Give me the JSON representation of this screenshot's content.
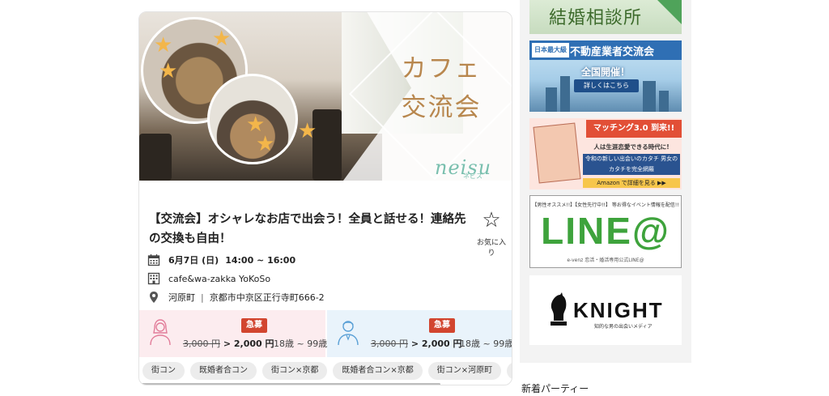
{
  "event": {
    "hero_title_line1": "カフェ",
    "hero_title_line2": "交流会",
    "hero_logo": "neisu",
    "hero_logo_sub": "ネビス",
    "title": "【交流会】オシャレなお店で出会う！全員と話せる！連絡先の交換も自由！",
    "favorite_label": "お気に入り",
    "date": "6月7日 (日)",
    "time": "14:00 ~ 16:00",
    "venue": "cafe&wa-zakka YoKoSo",
    "area": "河原町",
    "separator": "|",
    "address": "京都市中京区正行寺町666-2",
    "female": {
      "badge": "急募",
      "old_price": "3,000 円",
      "price": "> 2,000 円",
      "age": "18歳 ~ 99歳"
    },
    "male": {
      "badge": "急募",
      "old_price": "3,000 円",
      "price": "> 2,000 円",
      "age": "18歳 ~ 99歳"
    },
    "tags": [
      "街コン",
      "既婚者合コン",
      "街コン×京都",
      "既婚者合コン×京都",
      "街コン×河原町",
      "既"
    ]
  },
  "sidebar": {
    "banner1_title": "結婚相談所",
    "banner2_tag": "日本最大級",
    "banner2_title": "不動産業者交流会",
    "banner2_sub": "全国開催！",
    "banner2_button": "詳しくはこちら",
    "banner3_head": "マッチング3.0 到来!!",
    "banner3_line": "人は生涯恋愛できる時代に!",
    "banner3_box": "令和の新しい出会いのカタチ 男女のカタチを完全網羅",
    "banner3_cta": "Amazon で詳細を見る ▶▶",
    "banner4_top": "【男性オススメ!!】【女性先行中!!】 等お得なイベント情報を配信!!",
    "banner4_big": "LINE@",
    "banner4_bottom": "e-venz 恋活・婚活専用公式LINE@",
    "banner5_title": "KNIGHT",
    "banner5_sub": "知的な男の出会いメディア"
  },
  "footer": {
    "new_parties": "新着パーティー"
  }
}
